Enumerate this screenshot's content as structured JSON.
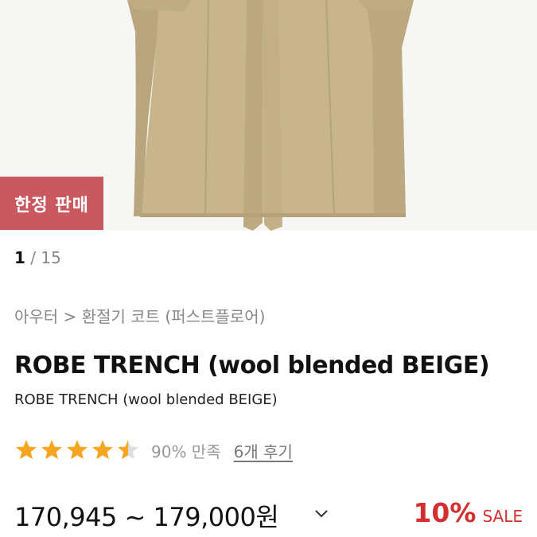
{
  "product_image": {
    "alt_icon": "trench-coat-photo"
  },
  "badge": {
    "label": "한정 판매",
    "color": "#c9595f"
  },
  "gallery": {
    "current": "1",
    "separator": "/",
    "total": "15"
  },
  "breadcrumb": {
    "text": "아우터 > 환절기 코트 (퍼스트플로어)"
  },
  "product": {
    "title": "ROBE TRENCH (wool blended BEIGE)",
    "subtitle": "ROBE TRENCH (wool blended BEIGE)"
  },
  "rating": {
    "stars": 4.5,
    "star_color": "#f5a623",
    "satisfaction": "90% 만족",
    "reviews_label": "6개 후기"
  },
  "price": {
    "range": "170,945 ~ 179,000원",
    "discount_pct": "10%",
    "sale_label": "SALE",
    "sale_color": "#d32f2f"
  }
}
